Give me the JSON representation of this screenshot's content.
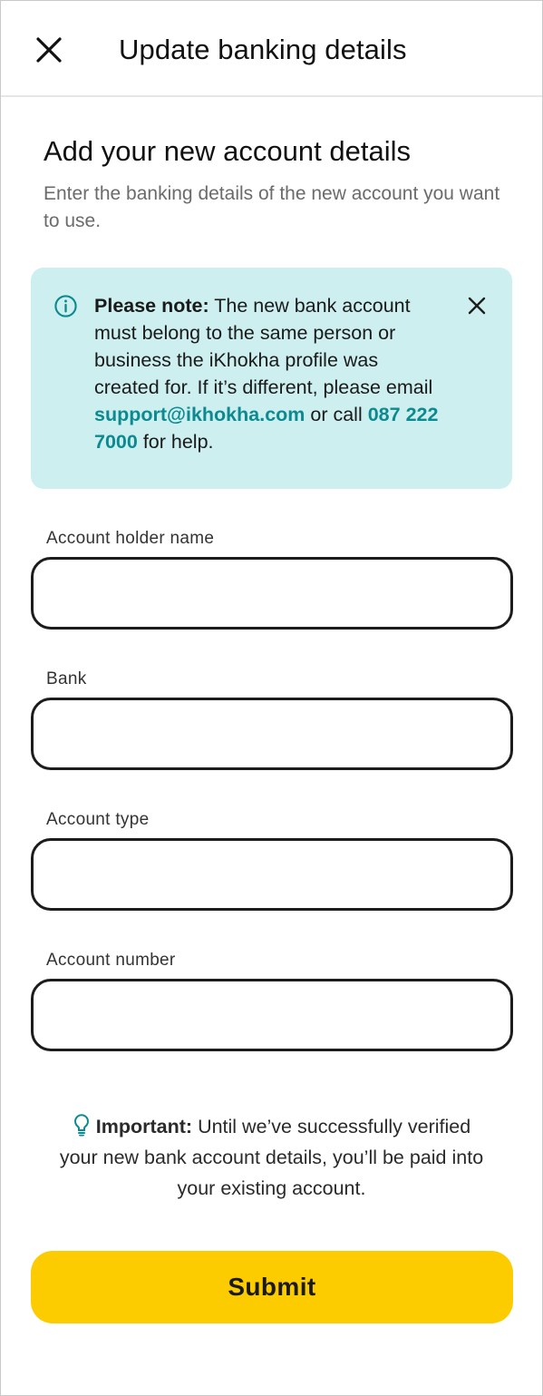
{
  "header": {
    "title": "Update banking details"
  },
  "intro": {
    "title": "Add your new account details",
    "subtitle": "Enter the banking details of the new account you want to use."
  },
  "note": {
    "label": "Please note:",
    "text_before_email": " The new bank account must belong to the same person or business the iKhokha profile was created for. If it’s different, please email ",
    "email": "support@ikhokha.com",
    "text_between": " or call ",
    "phone": "087 222 7000",
    "text_after": " for help.",
    "info_icon": "info-circle-icon",
    "dismiss_icon": "close-icon"
  },
  "form": {
    "fields": [
      {
        "label": "Account holder name",
        "value": ""
      },
      {
        "label": "Bank",
        "value": ""
      },
      {
        "label": "Account type",
        "value": ""
      },
      {
        "label": "Account number",
        "value": ""
      }
    ]
  },
  "important": {
    "label": "Important:",
    "text": " Until we’ve successfully verified your new bank account details, you’ll be paid into your existing account.",
    "icon": "lightbulb-icon"
  },
  "submit": {
    "label": "Submit"
  },
  "colors": {
    "accent_yellow": "#fccb00",
    "note_background": "#cdeff0",
    "link_teal": "#0c8a8f"
  }
}
